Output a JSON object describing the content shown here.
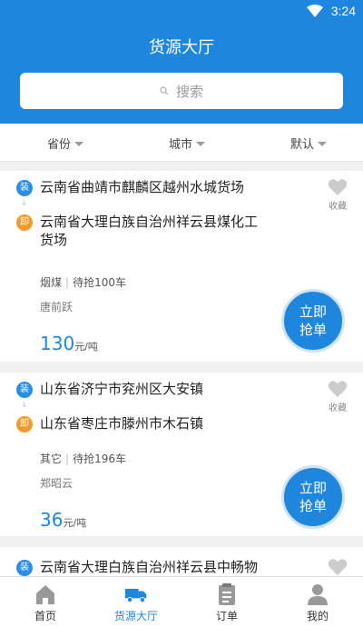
{
  "status": {
    "time": "3:24"
  },
  "header": {
    "title": "货源大厅",
    "search_placeholder": "搜索"
  },
  "filters": [
    {
      "label": "省份"
    },
    {
      "label": "城市"
    },
    {
      "label": "默认"
    }
  ],
  "cards": [
    {
      "load_badge": "装",
      "unload_badge": "卸",
      "from": "云南省曲靖市麒麟区越州水城货场",
      "to_line1": "云南省大理白族自治州祥云县煤化工",
      "to_line2": "货场",
      "cargo": "烟煤",
      "remaining": "待抢100车",
      "person": "唐前跃",
      "price": "130",
      "unit": "元/吨",
      "fav_label": "收藏",
      "grab_line1": "立即",
      "grab_line2": "抢单"
    },
    {
      "load_badge": "装",
      "unload_badge": "卸",
      "from": "山东省济宁市兖州区大安镇",
      "to_line1": "山东省枣庄市滕州市木石镇",
      "cargo": "其它",
      "remaining": "待抢196车",
      "person": "郑昭云",
      "price": "36",
      "unit": "元/吨",
      "fav_label": "收藏",
      "grab_line1": "立即",
      "grab_line2": "抢单"
    },
    {
      "load_badge": "装",
      "from": "云南省大理白族自治州祥云县中畅物"
    }
  ],
  "tabbar": [
    {
      "label": "首页"
    },
    {
      "label": "货源大厅"
    },
    {
      "label": "订单"
    },
    {
      "label": "我的"
    }
  ],
  "colors": {
    "primary": "#1f86de",
    "load": "#2b8de3",
    "unload": "#f09a2b",
    "active_tab": "#1f86de"
  }
}
